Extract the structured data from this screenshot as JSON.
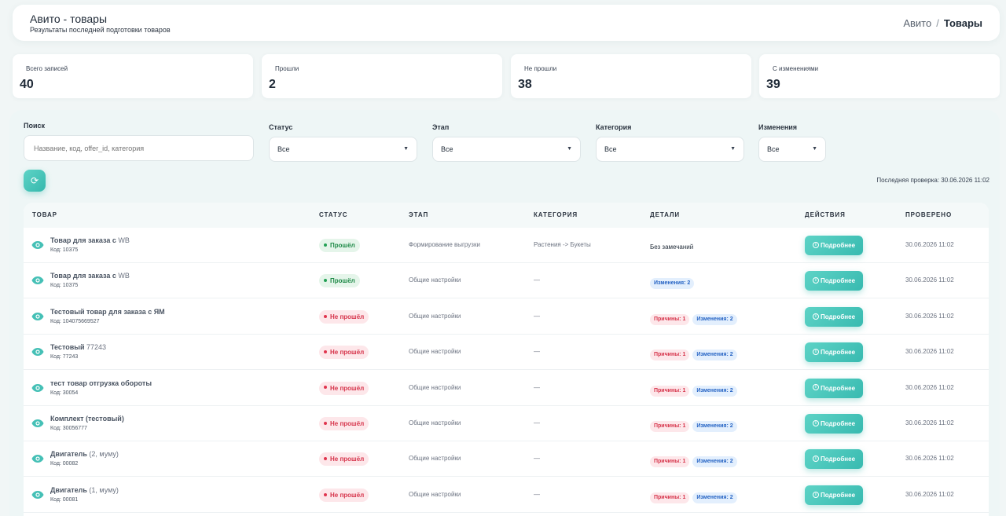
{
  "header": {
    "title": "Авито - товары",
    "subtitle": "Результаты последней подготовки товаров",
    "breadcrumb": [
      "Авито",
      "/",
      "Товары"
    ]
  },
  "stats": [
    {
      "label": "Всего записей",
      "value": "40"
    },
    {
      "label": "Прошли",
      "value": "2"
    },
    {
      "label": "Не прошли",
      "value": "38"
    },
    {
      "label": "С изменениями",
      "value": "39"
    }
  ],
  "filters": {
    "search_label": "Поиск",
    "search_placeholder": "Название, код, offer_id, категория",
    "status_label": "Статус",
    "status_value": "Все",
    "stage_label": "Этап",
    "stage_value": "Все",
    "category_label": "Категория",
    "category_value": "Все",
    "changes_label": "Изменения",
    "changes_value": "Все",
    "last_check": "Последняя проверка: 30.06.2026 11:02"
  },
  "table": {
    "columns": [
      "ТОВАР",
      "СТАТУС",
      "ЭТАП",
      "КАТЕГОРИЯ",
      "ДЕТАЛИ",
      "ДЕЙСТВИЯ",
      "ПРОВЕРЕНО"
    ],
    "more_label": "Подробнее",
    "rows": [
      {
        "name": "Товар для заказа с",
        "name2": " WB",
        "code": "Код: 10375",
        "status": "Прошёл",
        "stage": "Формирование выгрузки",
        "category": "Растения -> Букеты",
        "details_text": "Без замечаний",
        "reasons": "",
        "changes": "",
        "checked": "30.06.2026 11:02"
      },
      {
        "name": "Товар для заказа с",
        "name2": " WB",
        "code": "Код: 10375",
        "status": "Прошёл",
        "stage": "Общие настройки",
        "category": "—",
        "details_text": "",
        "reasons": "",
        "changes": "Изменения: 2",
        "checked": "30.06.2026 11:02"
      },
      {
        "name": "Тестовый товар для заказа с ЯМ",
        "name2": "",
        "code": "Код: 104075669527",
        "status": "Не прошёл",
        "stage": "Общие настройки",
        "category": "—",
        "details_text": "",
        "reasons": "Причины: 1",
        "changes": "Изменения: 2",
        "checked": "30.06.2026 11:02"
      },
      {
        "name": "Тестовый",
        "name2": " 77243",
        "code": "Код: 77243",
        "status": "Не прошёл",
        "stage": "Общие настройки",
        "category": "—",
        "details_text": "",
        "reasons": "Причины: 1",
        "changes": "Изменения: 2",
        "checked": "30.06.2026 11:02"
      },
      {
        "name": "тест товар отгрузка обороты",
        "name2": "",
        "code": "Код: 30054",
        "status": "Не прошёл",
        "stage": "Общие настройки",
        "category": "—",
        "details_text": "",
        "reasons": "Причины: 1",
        "changes": "Изменения: 2",
        "checked": "30.06.2026 11:02"
      },
      {
        "name": "Комплект (тестовый)",
        "name2": "",
        "code": "Код: 30056777",
        "status": "Не прошёл",
        "stage": "Общие настройки",
        "category": "—",
        "details_text": "",
        "reasons": "Причины: 1",
        "changes": "Изменения: 2",
        "checked": "30.06.2026 11:02"
      },
      {
        "name": "Двигатель",
        "name2": " (2, муму)",
        "code": "Код: 00082",
        "status": "Не прошёл",
        "stage": "Общие настройки",
        "category": "—",
        "details_text": "",
        "reasons": "Причины: 1",
        "changes": "Изменения: 2",
        "checked": "30.06.2026 11:02"
      },
      {
        "name": "Двигатель",
        "name2": " (1, муму)",
        "code": "Код: 00081",
        "status": "Не прошёл",
        "stage": "Общие настройки",
        "category": "—",
        "details_text": "",
        "reasons": "Причины: 1",
        "changes": "Изменения: 2",
        "checked": "30.06.2026 11:02"
      }
    ]
  },
  "colors": {
    "accent": "#3fc1b5",
    "pass_bg": "#e5f5ea",
    "fail_bg": "#fde7ea",
    "changes_bg": "#e3effd"
  }
}
